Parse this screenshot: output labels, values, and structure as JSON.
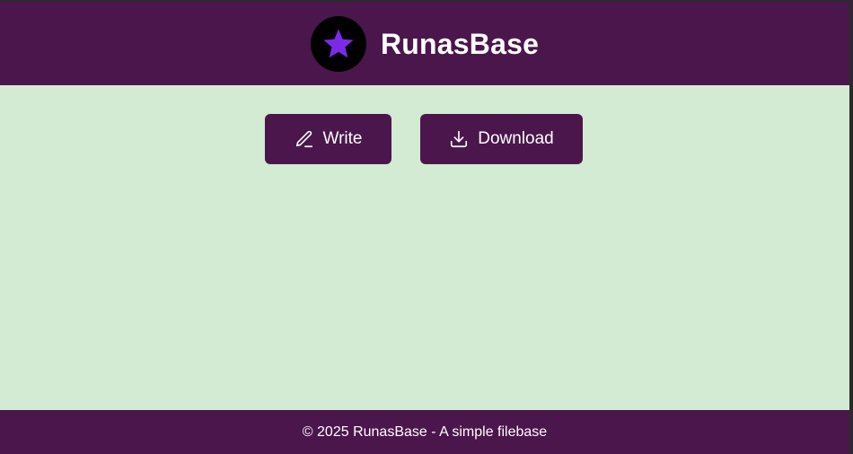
{
  "header": {
    "title": "RunasBase",
    "logo_icon": "star-icon",
    "logo_color": "#7d2ae8"
  },
  "actions": {
    "write_label": "Write",
    "write_icon": "pencil-icon",
    "download_label": "Download",
    "download_icon": "download-icon"
  },
  "footer": {
    "text": "© 2025 RunasBase - A simple filebase"
  },
  "colors": {
    "brand": "#4b164c",
    "background": "#e8f3e8",
    "pattern_tile": "#d3ead3"
  }
}
